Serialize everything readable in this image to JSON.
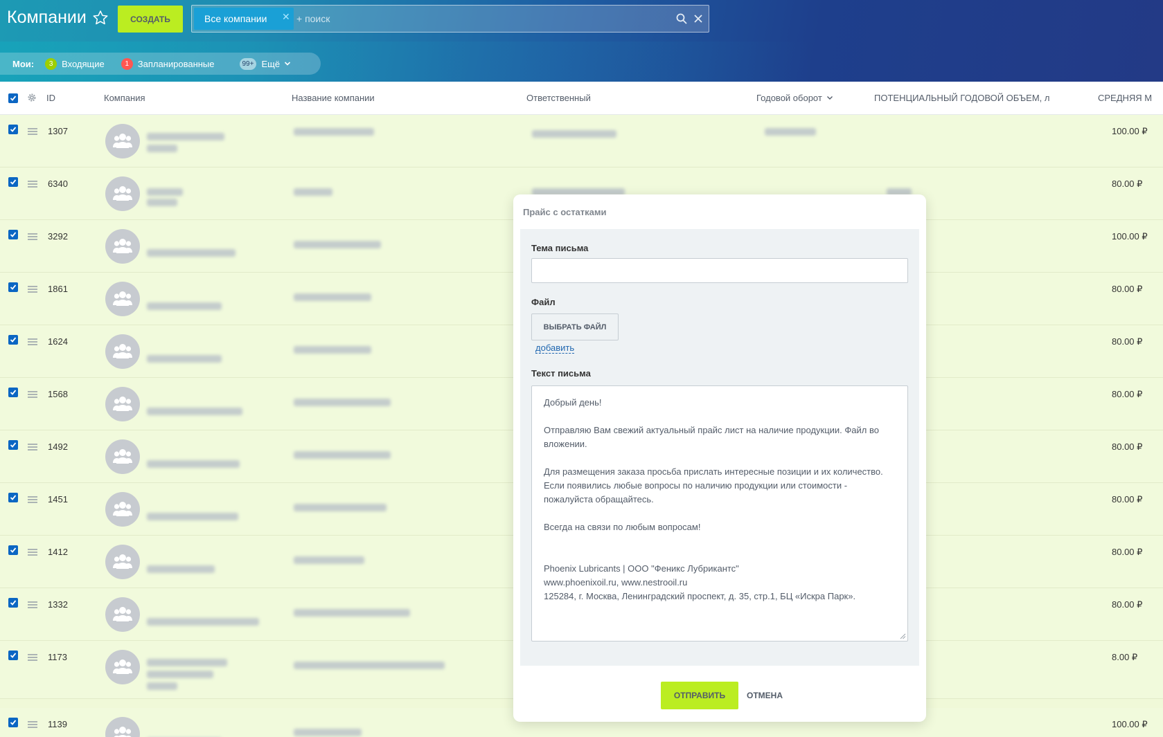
{
  "header": {
    "title": "Компании",
    "create_label": "СОЗДАТЬ",
    "filter_chip": "Все компании",
    "search_placeholder": "+ поиск"
  },
  "counters": {
    "title": "Мои:",
    "items": [
      {
        "badge": "3",
        "label": "Входящие"
      },
      {
        "badge": "1",
        "label": "Запланированные"
      },
      {
        "badge": "99+",
        "label": "Ещё"
      }
    ]
  },
  "columns": {
    "id": "ID",
    "company": "Компания",
    "company_name": "Название компании",
    "responsible": "Ответственный",
    "annual_turnover": "Годовой оборот",
    "potential_volume": "ПОТЕНЦИАЛЬНЫЙ ГОДОВОЙ ОБЪЕМ, л",
    "average": "СРЕДНЯЯ М"
  },
  "rows": [
    {
      "id": "1307",
      "price": "100.00 ₽"
    },
    {
      "id": "6340",
      "price": "80.00 ₽"
    },
    {
      "id": "3292",
      "price": "100.00 ₽"
    },
    {
      "id": "1861",
      "price": "80.00 ₽"
    },
    {
      "id": "1624",
      "price": "80.00 ₽"
    },
    {
      "id": "1568",
      "price": "80.00 ₽"
    },
    {
      "id": "1492",
      "price": "80.00 ₽"
    },
    {
      "id": "1451",
      "price": "80.00 ₽"
    },
    {
      "id": "1412",
      "price": "80.00 ₽"
    },
    {
      "id": "1332",
      "price": "80.00 ₽"
    },
    {
      "id": "1173",
      "price": "8.00 ₽"
    },
    {
      "id": "1139",
      "price": "100.00 ₽"
    }
  ],
  "modal": {
    "title": "Прайс с остатками",
    "subject_label": "Тема письма",
    "subject_value": "",
    "file_label": "Файл",
    "file_button": "ВЫБРАТЬ ФАЙЛ",
    "add_link": "добавить",
    "text_label": "Текст письма",
    "text_value": "Добрый день!\n\nОтправляю Вам свежий актуальный прайс лист на наличие продукции. Файл во вложении.\n\nДля размещения заказа просьба прислать интересные позиции и их количество.\nЕсли появились любые вопросы по наличию продукции или стоимости - пожалуйста обращайтесь.\n\nВсегда на связи по любым вопросам!\n\n\nPhoenix Lubricants | ООО \"Феникс Лубрикантс\"\nwww.phoenixoil.ru, www.nestrooil.ru\n125284, г. Москва, Ленинградский проспект, д. 35, стр.1, БЦ «Искра Парк».",
    "send_label": "ОТПРАВИТЬ",
    "cancel_label": "ОТМЕНА"
  },
  "colors": {
    "accent_green": "#bbed21",
    "row_bg": "#f1fadc",
    "checkbox_blue": "#0b66c3"
  }
}
